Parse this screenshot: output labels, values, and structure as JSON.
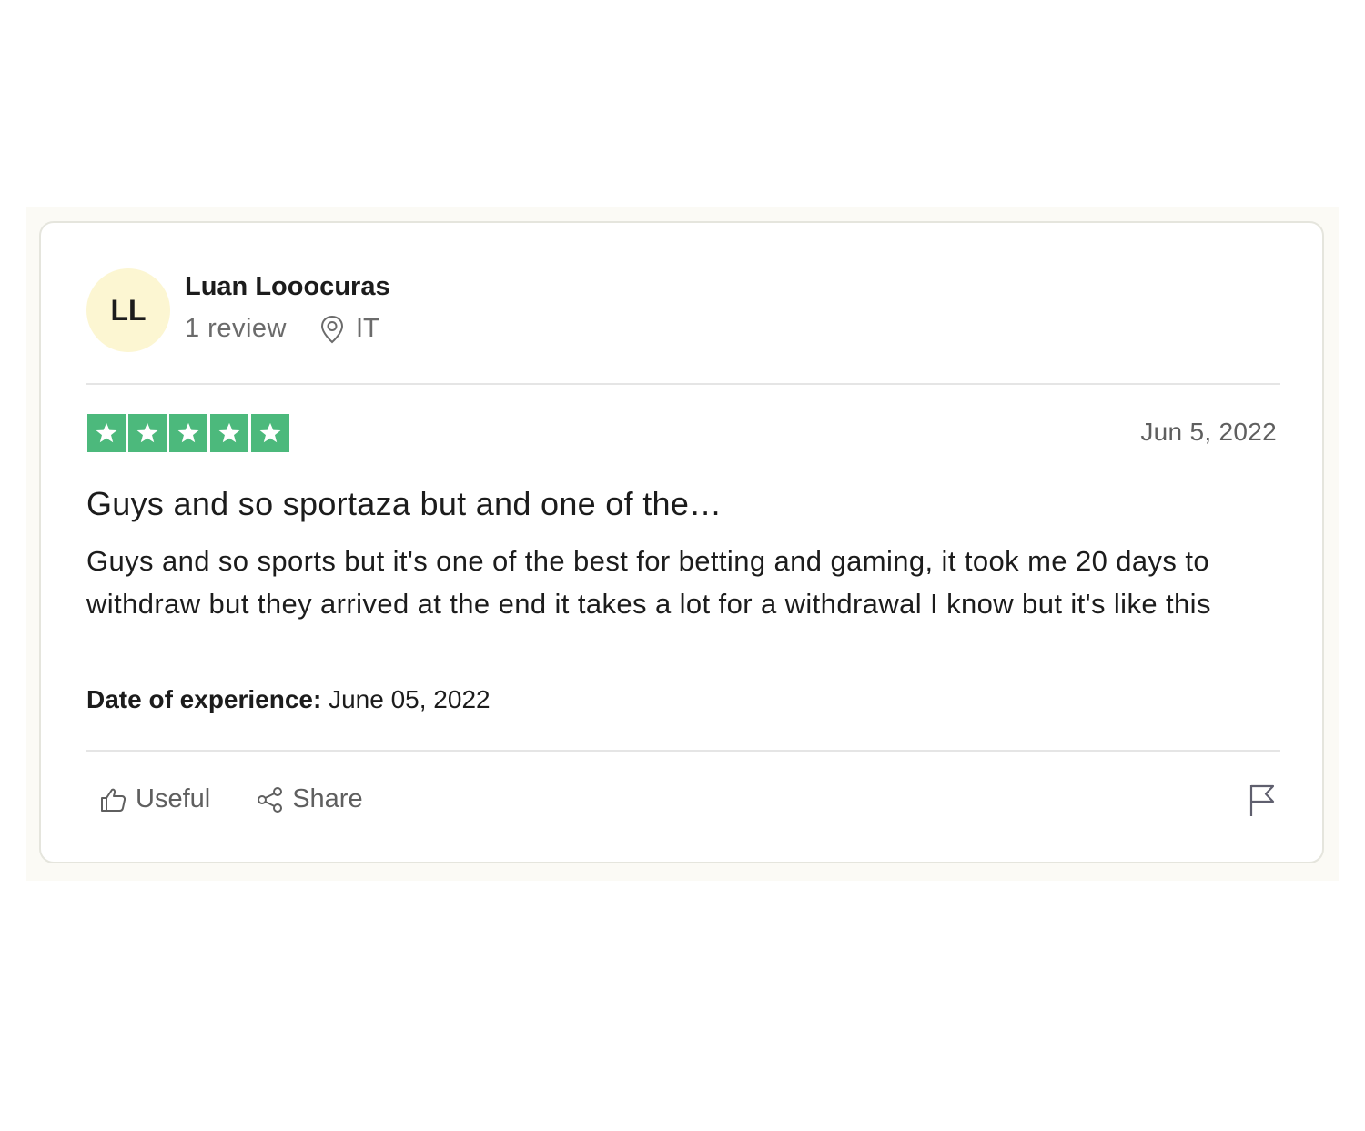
{
  "reviewer": {
    "initials": "LL",
    "name": "Luan Looocuras",
    "review_count": "1 review",
    "country": "IT",
    "location_icon": "location-pin-icon"
  },
  "review": {
    "rating": 5,
    "stars_max": 5,
    "star_color": "#4cb97c",
    "date": "Jun 5, 2022",
    "title": "Guys and so sportaza but and one of the…",
    "body": "Guys and so sports but it's one of the best for betting and gaming, it took me 20 days to withdraw but they arrived at the end it takes a lot for a withdrawal I know but it's like this",
    "experience_label": "Date of experience:",
    "experience_date": "June 05, 2022"
  },
  "actions": {
    "useful_label": "Useful",
    "useful_icon": "thumbs-up-icon",
    "share_label": "Share",
    "share_icon": "share-icon",
    "flag_icon": "flag-icon"
  },
  "colors": {
    "avatar_bg": "#fcf6d2",
    "card_border": "#e5e5dd",
    "backdrop": "#fbfaf5"
  }
}
